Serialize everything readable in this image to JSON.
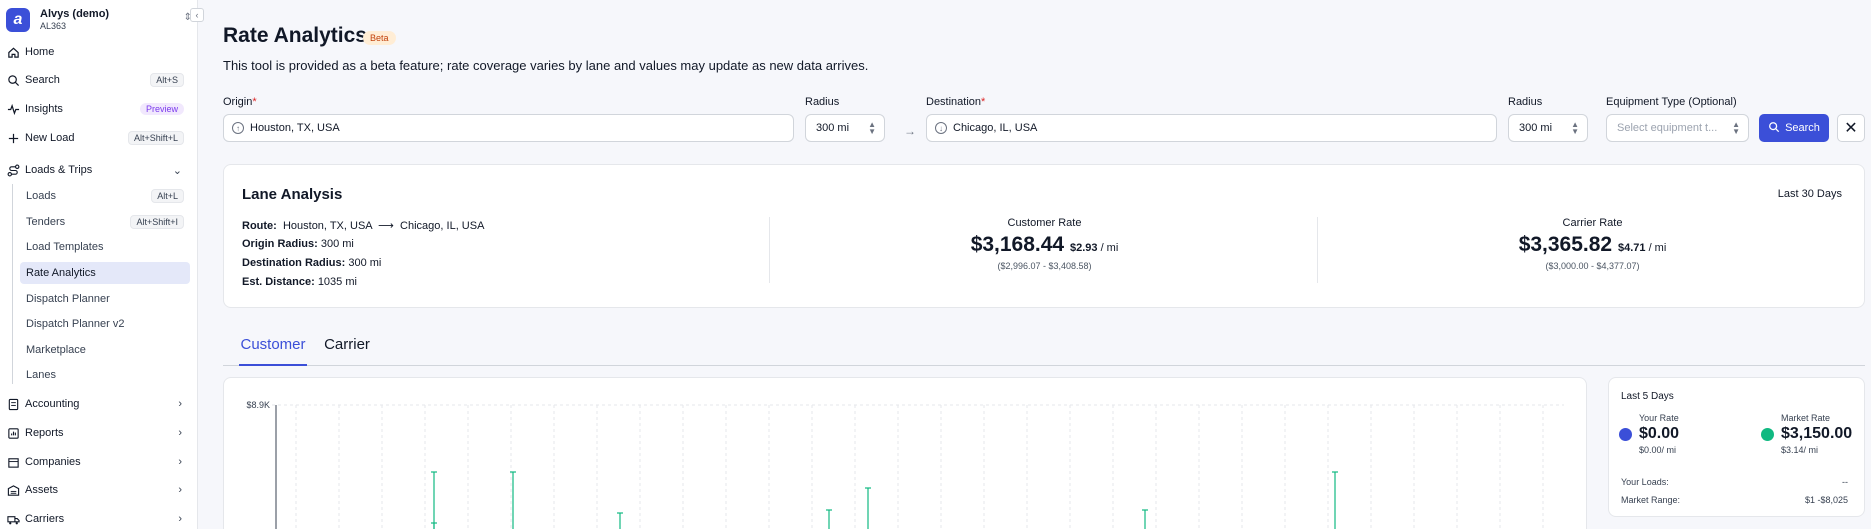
{
  "org": {
    "name": "Alvys (demo)",
    "id": "AL363",
    "logo_letter": "a"
  },
  "colors": {
    "accent": "#3b4fd8",
    "market": "#10b981",
    "beta_bg": "#ffedd5",
    "preview_bg": "#f1e8fd"
  },
  "nav": {
    "home": "Home",
    "search": "Search",
    "search_kbd": "Alt+S",
    "insights": "Insights",
    "insights_badge": "Preview",
    "new_load": "New Load",
    "new_load_kbd": "Alt+Shift+L",
    "loads_trips": "Loads & Trips",
    "sub": {
      "loads": "Loads",
      "loads_kbd": "Alt+L",
      "tenders": "Tenders",
      "tenders_kbd": "Alt+Shift+I",
      "load_templates": "Load Templates",
      "rate_analytics": "Rate Analytics",
      "dispatch_planner": "Dispatch Planner",
      "dispatch_planner_v2": "Dispatch Planner v2",
      "marketplace": "Marketplace",
      "lanes": "Lanes"
    },
    "accounting": "Accounting",
    "reports": "Reports",
    "companies": "Companies",
    "assets": "Assets",
    "carriers": "Carriers"
  },
  "page": {
    "title": "Rate Analytics",
    "badge": "Beta",
    "subtitle": "This tool is provided as a beta feature; rate coverage varies by lane and values may update as new data arrives."
  },
  "form": {
    "origin_label": "Origin",
    "origin_value": "Houston, TX, USA",
    "radius_label": "Radius",
    "origin_radius": "300 mi",
    "destination_label": "Destination",
    "destination_value": "Chicago, IL, USA",
    "dest_radius": "300 mi",
    "equipment_label": "Equipment Type (Optional)",
    "equipment_placeholder": "Select equipment t...",
    "search_label": "Search"
  },
  "lane": {
    "title": "Lane Analysis",
    "period": "Last 30 Days",
    "route_label": "Route:",
    "route_origin": "Houston, TX, USA",
    "route_destination": "Chicago, IL, USA",
    "origin_radius_label": "Origin Radius:",
    "origin_radius_value": "300 mi",
    "dest_radius_label": "Destination Radius:",
    "dest_radius_value": "300 mi",
    "distance_label": "Est. Distance:",
    "distance_value": "1035 mi",
    "customer": {
      "label": "Customer Rate",
      "value": "$3,168.44",
      "per_mile": "$2.93",
      "unit": "/ mi",
      "range": "($2,996.07 - $3,408.58)"
    },
    "carrier": {
      "label": "Carrier Rate",
      "value": "$3,365.82",
      "per_mile": "$4.71",
      "unit": "/ mi",
      "range": "($3,000.00 - $4,377.07)"
    }
  },
  "tabs": [
    "Customer",
    "Carrier"
  ],
  "chart": {
    "y_top_label": "$8.9K"
  },
  "summary": {
    "title": "Last 5 Days",
    "your_rate_label": "Your Rate",
    "your_rate_value": "$0.00",
    "your_rate_per_mile": "$0.00/ mi",
    "market_rate_label": "Market Rate",
    "market_rate_value": "$3,150.00",
    "market_rate_per_mile": "$3.14/ mi",
    "your_loads_label": "Your Loads:",
    "your_loads_value": "--",
    "market_range_label": "Market Range:",
    "market_range_value": "$1 -$8,025"
  }
}
